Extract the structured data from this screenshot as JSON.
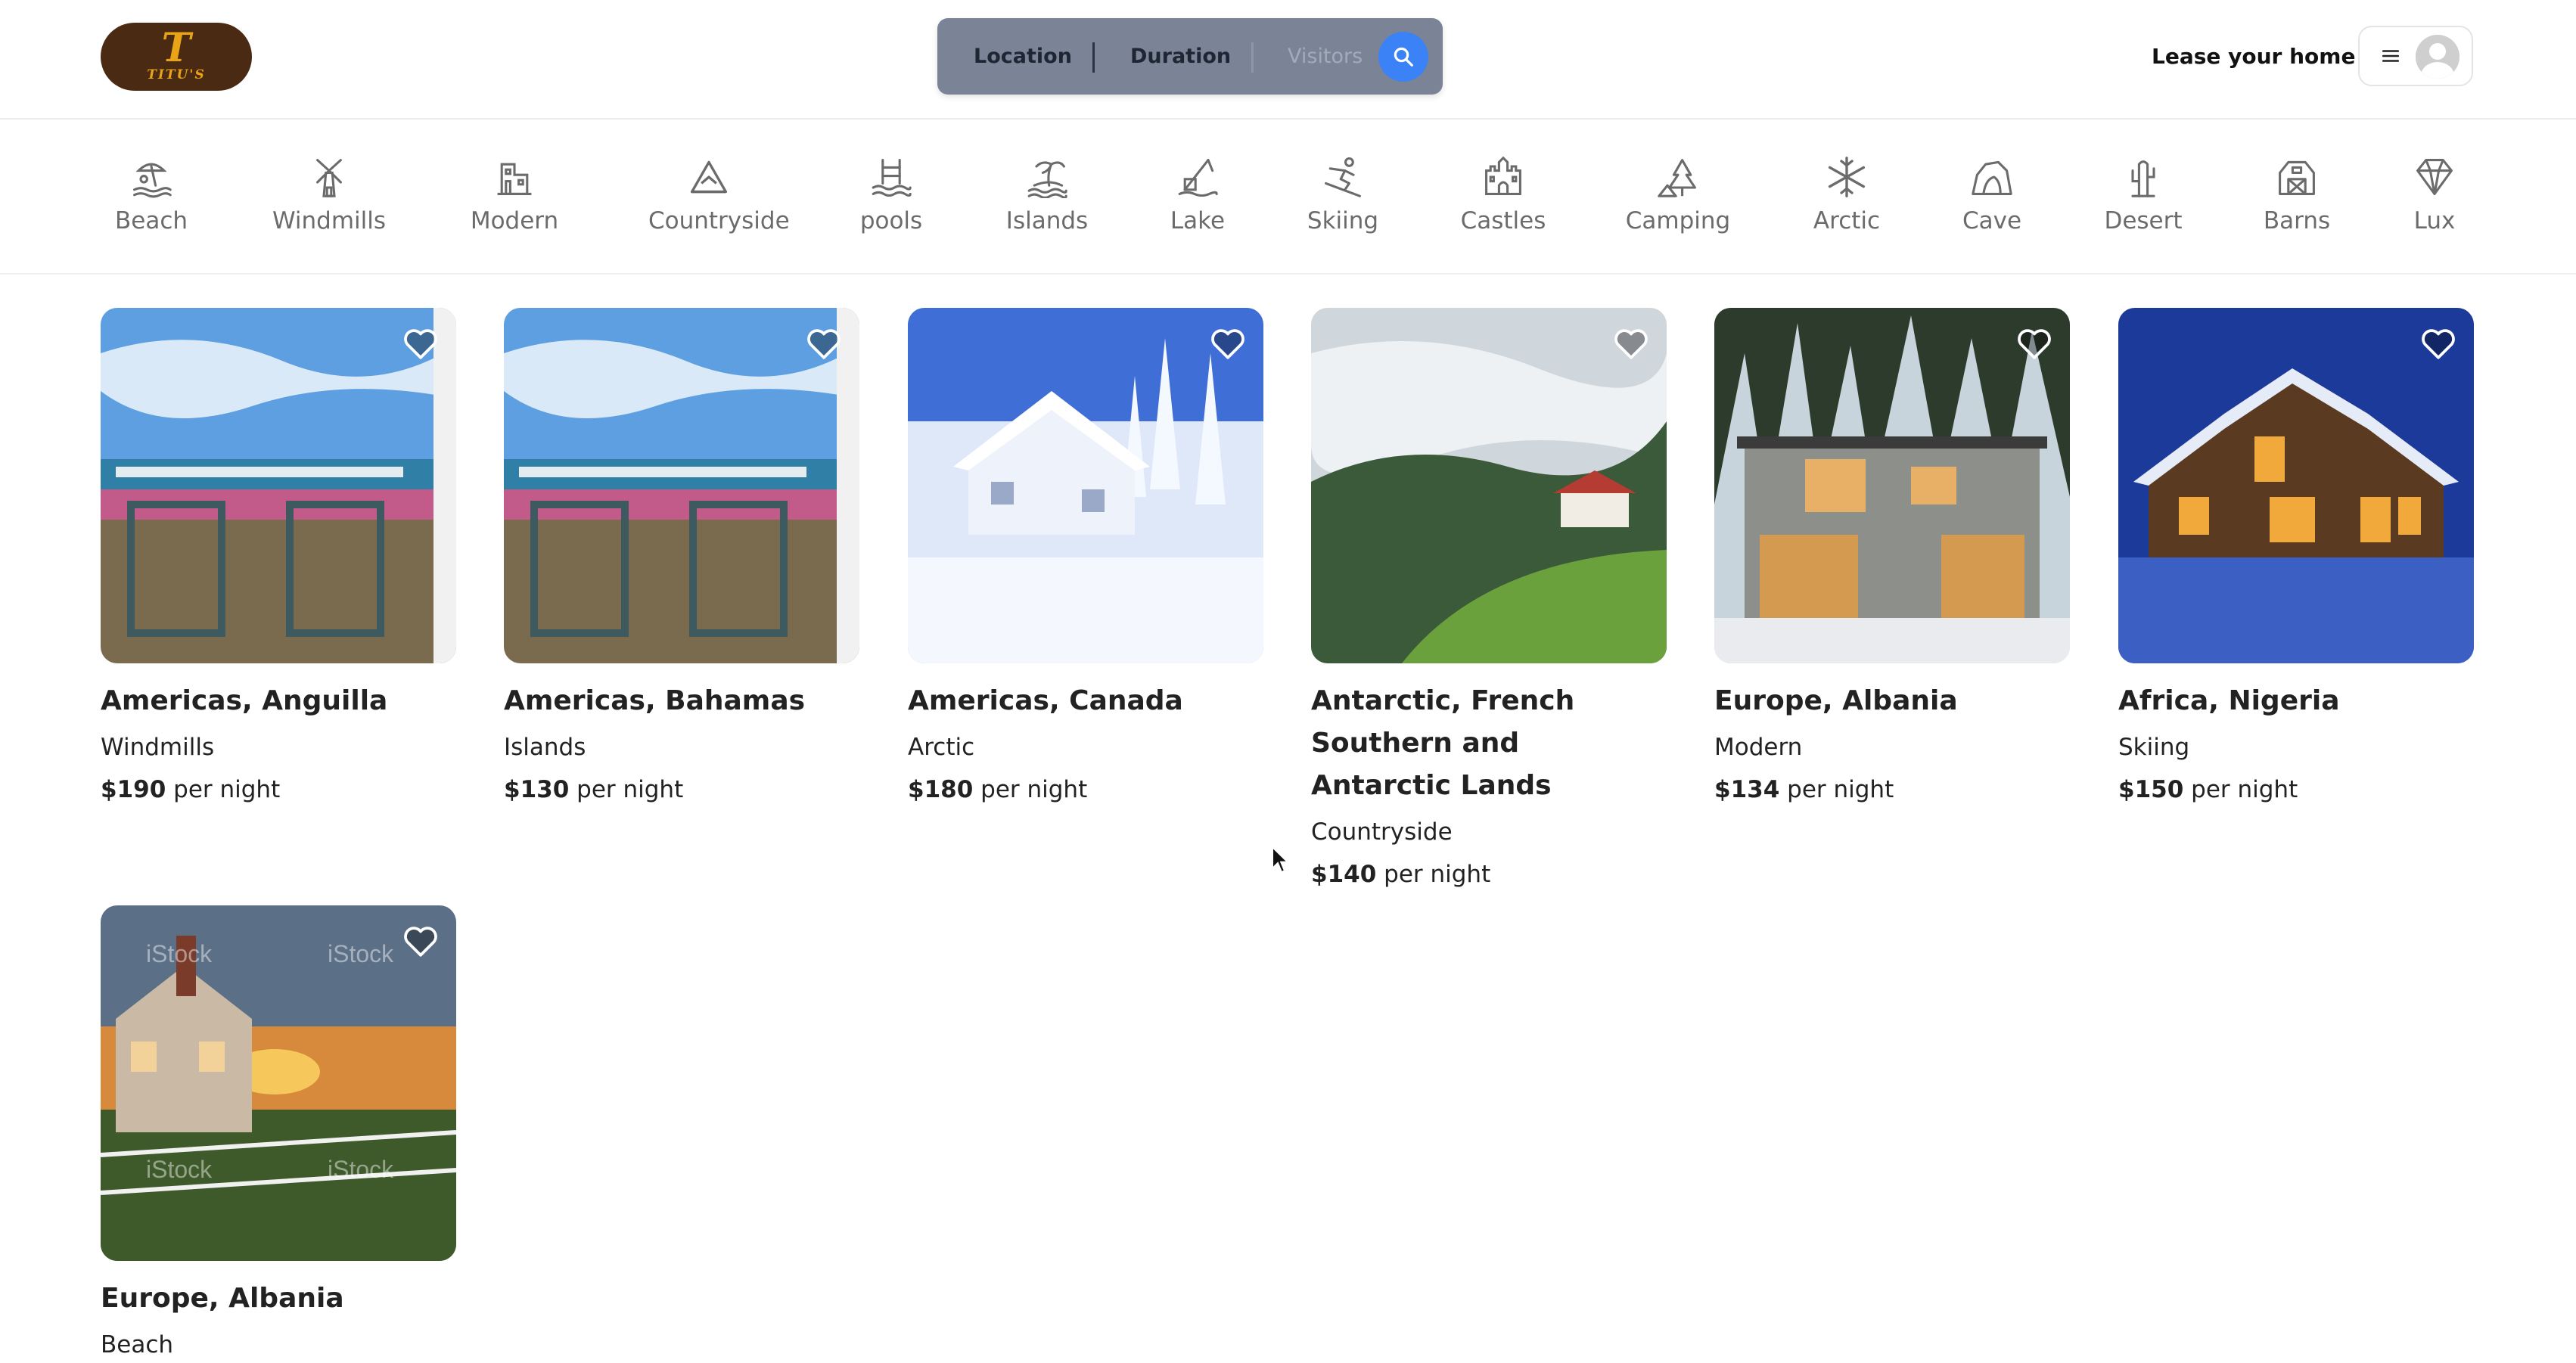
{
  "header": {
    "logo": {
      "mark": "T",
      "word": "TITU'S"
    },
    "search": {
      "location": "Location",
      "duration": "Duration",
      "visitors": "Visitors"
    },
    "lease_label": "Lease your home"
  },
  "categories": [
    {
      "label": "Beach",
      "icon": "beach-icon"
    },
    {
      "label": "Windmills",
      "icon": "windmill-icon"
    },
    {
      "label": "Modern",
      "icon": "modern-building-icon"
    },
    {
      "label": "Countryside",
      "icon": "mountain-icon"
    },
    {
      "label": "pools",
      "icon": "pool-icon"
    },
    {
      "label": "Islands",
      "icon": "island-icon"
    },
    {
      "label": "Lake",
      "icon": "lake-icon"
    },
    {
      "label": "Skiing",
      "icon": "skiing-icon"
    },
    {
      "label": "Castles",
      "icon": "castle-icon"
    },
    {
      "label": "Camping",
      "icon": "camping-icon"
    },
    {
      "label": "Arctic",
      "icon": "snowflake-icon"
    },
    {
      "label": "Cave",
      "icon": "cave-icon"
    },
    {
      "label": "Desert",
      "icon": "cactus-icon"
    },
    {
      "label": "Barns",
      "icon": "barn-icon"
    },
    {
      "label": "Lux",
      "icon": "diamond-icon"
    }
  ],
  "listings": [
    {
      "location": "Americas, Anguilla",
      "category": "Windmills",
      "price": "$190",
      "unit": " per night"
    },
    {
      "location": "Americas, Bahamas",
      "category": "Islands",
      "price": "$130",
      "unit": " per night"
    },
    {
      "location": "Americas, Canada",
      "category": "Arctic",
      "price": "$180",
      "unit": " per night"
    },
    {
      "location": "Antarctic, French Southern and Antarctic Lands",
      "category": "Countryside",
      "price": "$140",
      "unit": " per night"
    },
    {
      "location": "Europe, Albania",
      "category": "Modern",
      "price": "$134",
      "unit": " per night"
    },
    {
      "location": "Africa, Nigeria",
      "category": "Skiing",
      "price": "$150",
      "unit": " per night"
    },
    {
      "location": "Europe, Albania",
      "category": "Beach",
      "price": "",
      "unit": ""
    }
  ],
  "photo_watermark": "iStock",
  "colors": {
    "search_bg": "#7a8496",
    "search_button": "#3b82f6",
    "logo_bg": "#4a2a12",
    "logo_fg": "#e8a317"
  }
}
